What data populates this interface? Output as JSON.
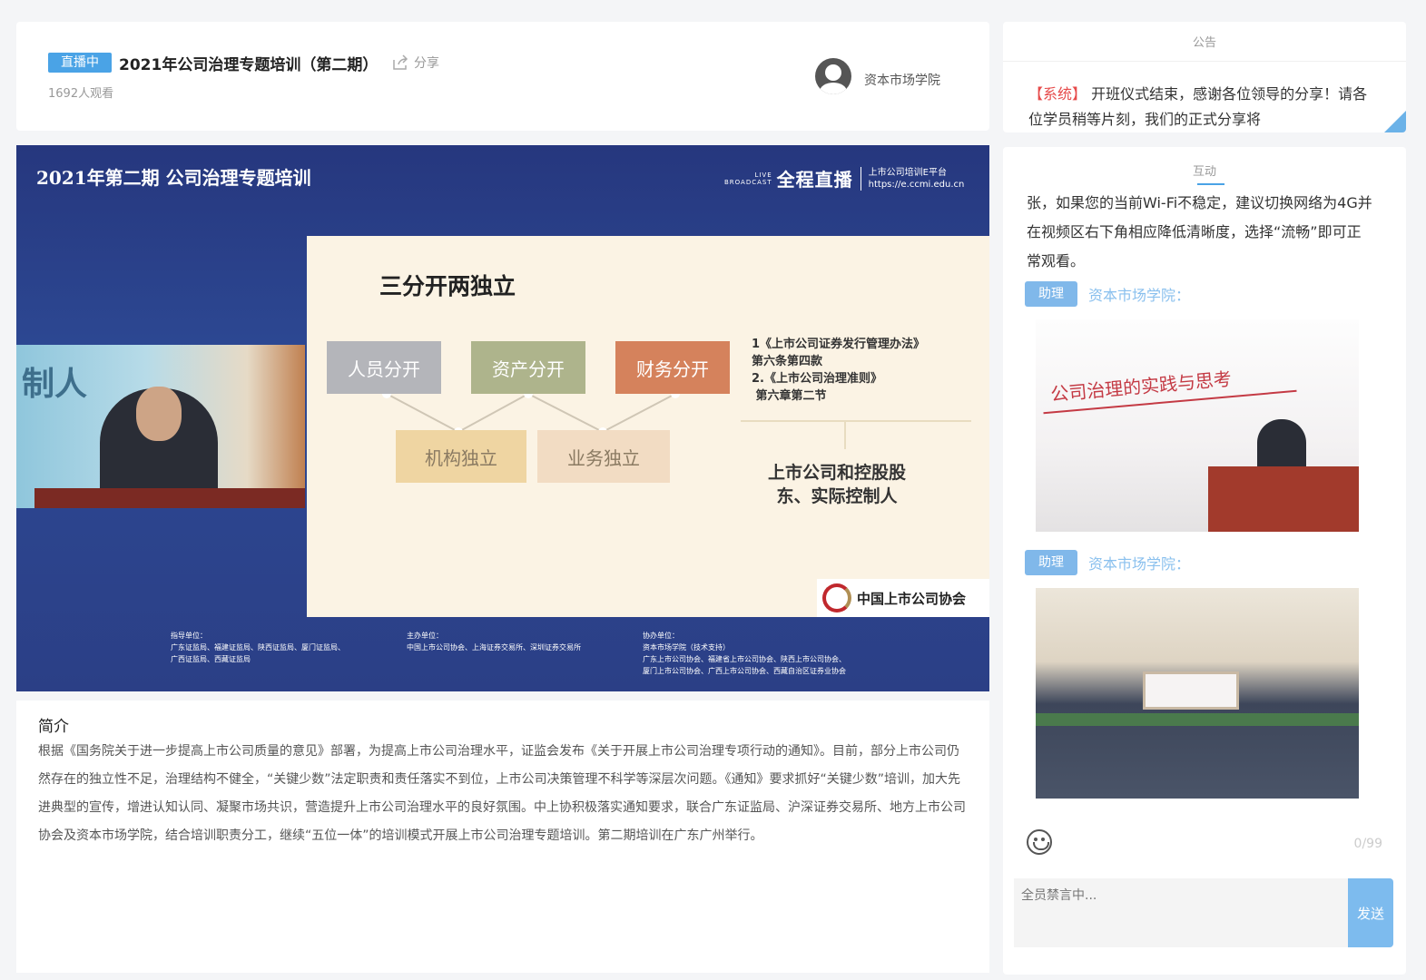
{
  "header": {
    "live_badge": "直播中",
    "title": "2021年公司治理专题培训（第二期）",
    "share_label": "分享",
    "viewer_count": "1692人观看",
    "host_name": "资本市场学院"
  },
  "video": {
    "top_title": "2021年第二期 公司治理专题培训",
    "broadcast_small": "LIVE\nBROADCAST",
    "broadcast_label": "全程直播",
    "platform_name": "上市公司培训E平台",
    "platform_url": "https://e.ccmi.edu.cn",
    "slide_title": "三分开两独立",
    "boxes": [
      "人员分开",
      "资产分开",
      "财务分开",
      "机构独立",
      "业务独立"
    ],
    "refs": "1《上市公司证券发行管理办法》\n第六条第四款\n2.《上市公司治理准则》\n 第六章第二节",
    "shareholder": "上市公司和控股股\n东、实际控制人",
    "association": "中国上市公司协会",
    "speaker_banner": "制人",
    "footer_cols": [
      "指导单位：\n广东证监局、福建证监局、陕西证监局、厦门证监局、\n广西证监局、西藏证监局",
      "主办单位：\n中国上市公司协会、上海证券交易所、深圳证券交易所",
      "协办单位：\n资本市场学院（技术支持）\n广东上市公司协会、福建省上市公司协会、陕西上市公司协会、\n厦门上市公司协会、广西上市公司协会、西藏自治区证券业协会"
    ]
  },
  "intro": {
    "heading": "简介",
    "body": "根据《国务院关于进一步提高上市公司质量的意见》部署，为提高上市公司治理水平，证监会发布《关于开展上市公司治理专项行动的通知》。目前，部分上市公司仍然存在的独立性不足，治理结构不健全，“关键少数”法定职责和责任落实不到位，上市公司决策管理不科学等深层次问题。《通知》要求抓好“关键少数”培训，加大先进典型的宣传，增进认知认同、凝聚市场共识，营造提升上市公司治理水平的良好氛围。中上协积极落实通知要求，联合广东证监局、沪深证券交易所、地方上市公司协会及资本市场学院，结合培训职责分工，继续“五位一体”的培训模式开展上市公司治理专题培训。第二期培训在广东广州举行。"
  },
  "notice": {
    "label": "公告",
    "system_tag": "【系统】",
    "text": "开班仪式结束，感谢各位领导的分享！请各位学员稍等片刻，我们的正式分享将"
  },
  "chat": {
    "label": "互动",
    "partial_text": "张，如果您的当前Wi-Fi不稳定，建议切换网络为4G并在视频区右下角相应降低清晰度，选择“流畅”即可正常观看。",
    "messages": [
      {
        "role": "助理",
        "sender": "资本市场学院：",
        "image_caption": "公司治理的实践与思考"
      },
      {
        "role": "助理",
        "sender": "资本市场学院："
      }
    ],
    "char_count": "0/99",
    "input_placeholder": "全员禁言中...",
    "send_label": "发送"
  },
  "colors": {
    "accent": "#4aa3e6",
    "system_red": "#e64a4a",
    "video_blue": "#2d4994"
  }
}
